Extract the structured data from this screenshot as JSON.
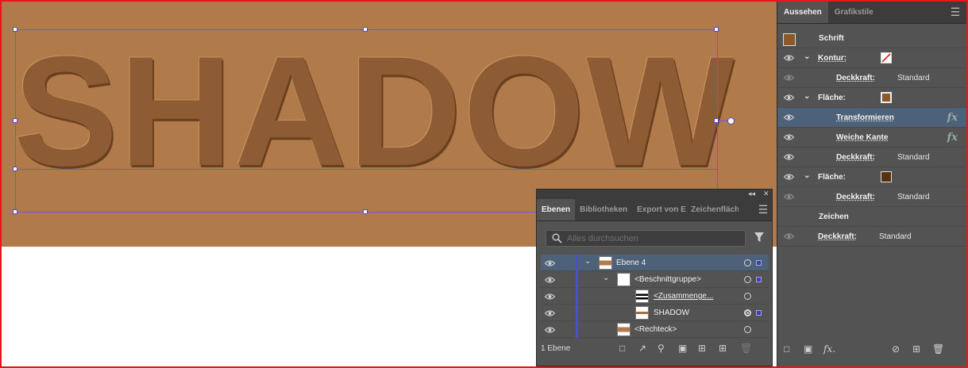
{
  "canvas": {
    "text": "SHADOW"
  },
  "appearance_panel": {
    "tabs": [
      "Aussehen",
      "Grafikstile"
    ],
    "object_label": "Schrift",
    "colors": {
      "fill_brown": "#8b5a2b",
      "fill_dark": "#5a3210",
      "selected_row": "#4d6179",
      "panel_bg": "#535353"
    },
    "rows": {
      "kontur": "Kontur:",
      "deckkraft_label": "Deckkraft:",
      "standard": "Standard",
      "flaeche": "Fläche:",
      "transformieren": "Transformieren",
      "weiche_kante": "Weiche Kante",
      "zeichen": "Zeichen",
      "fx": "fx"
    },
    "footer_icons": [
      "new-stroke-icon",
      "new-fill-icon",
      "add-effect-icon",
      "clear-appearance-icon",
      "duplicate-item-icon",
      "delete-item-icon"
    ],
    "footer_fx": "fx."
  },
  "layers_panel": {
    "tabs": [
      "Ebenen",
      "Bibliotheken",
      "Export von E",
      "Zeichenfläche"
    ],
    "search_placeholder": "Alles durchsuchen",
    "layers": [
      {
        "name": "Ebene 4"
      },
      {
        "name": "<Beschnittgruppe>"
      },
      {
        "name": "<Zusammenge..."
      },
      {
        "name": "SHADOW"
      },
      {
        "name": "<Rechteck>"
      }
    ],
    "footer_count": "1 Ebene"
  }
}
